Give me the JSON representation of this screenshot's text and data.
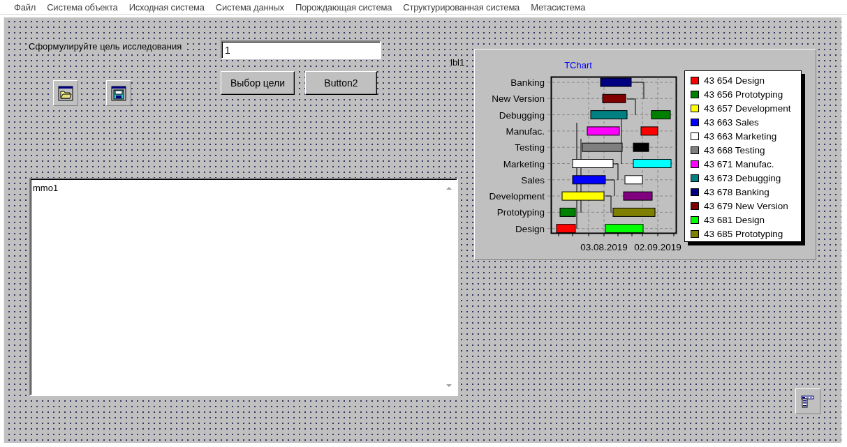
{
  "menu": [
    "Файл",
    "Система объекта",
    "Исходная система",
    "Система данных",
    "Порождающая система",
    "Структурированная система",
    "Метасистема"
  ],
  "form": {
    "goal_label": "Сформулируйте цель исследования",
    "goal_field": {
      "value": "1"
    },
    "buttons": [
      "Выбор цели",
      "Button2"
    ],
    "label": "lbl1",
    "memo": {
      "value": "mmo1"
    }
  },
  "chart": {
    "title": "TChart",
    "rows": [
      "Banking",
      "New Version",
      "Debugging",
      "Manufac.",
      "Testing",
      "Marketing",
      "Sales",
      "Development",
      "Prototyping",
      "Design"
    ],
    "x_tick_labels": [
      "03.08.2019",
      "02.09.2019"
    ],
    "legend": [
      {
        "label": "43 654 Design",
        "color": "#ff0000"
      },
      {
        "label": "43 656 Prototyping",
        "color": "#008000"
      },
      {
        "label": "43 657 Development",
        "color": "#ffff00"
      },
      {
        "label": "43 663 Sales",
        "color": "#0000ff"
      },
      {
        "label": "43 663 Marketing",
        "color": "#ffffff"
      },
      {
        "label": "43 668 Testing",
        "color": "#808080"
      },
      {
        "label": "43 671 Manufac.",
        "color": "#ff00ff"
      },
      {
        "label": "43 673 Debugging",
        "color": "#008080"
      },
      {
        "label": "43 678 Banking",
        "color": "#000080"
      },
      {
        "label": "43 679 New Version",
        "color": "#800000"
      },
      {
        "label": "43 681 Design",
        "color": "#00ff00"
      },
      {
        "label": "43 685 Prototyping",
        "color": "#808000"
      }
    ]
  }
}
